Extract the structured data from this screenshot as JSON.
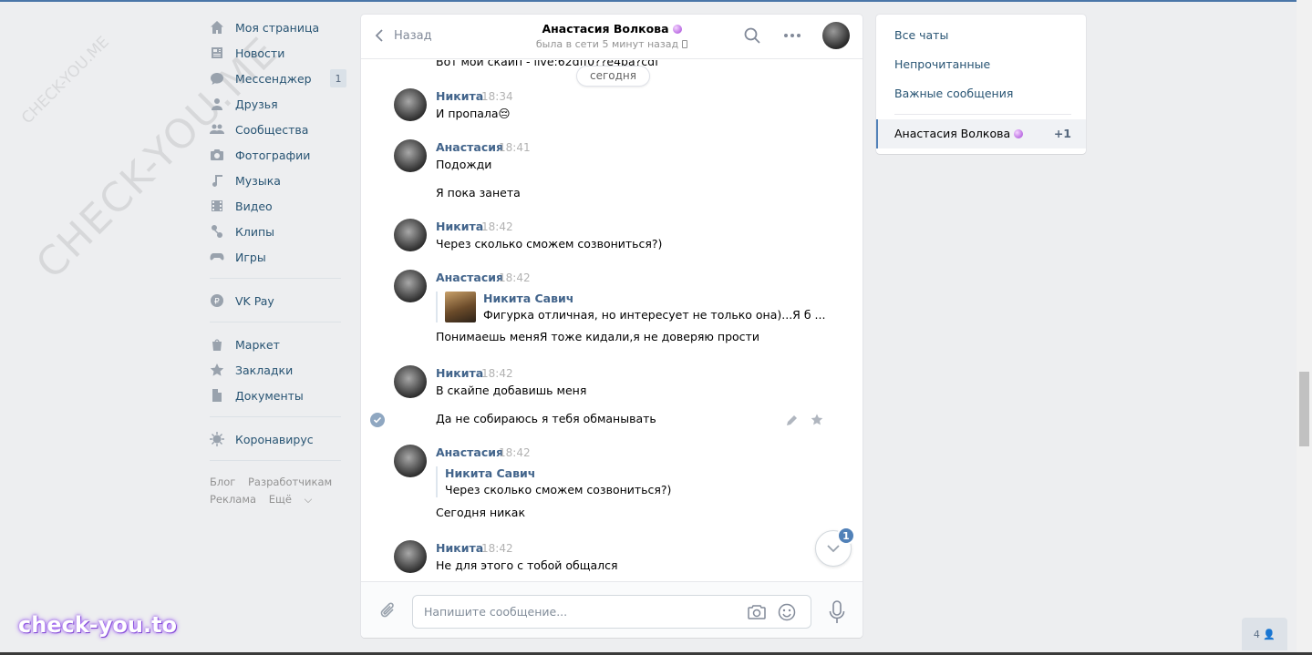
{
  "nav": {
    "items": [
      {
        "label": "Моя страница",
        "icon": "home-icon"
      },
      {
        "label": "Новости",
        "icon": "news-icon"
      },
      {
        "label": "Мессенджер",
        "icon": "messenger-icon",
        "badge": "1"
      },
      {
        "label": "Друзья",
        "icon": "friends-icon"
      },
      {
        "label": "Сообщества",
        "icon": "communities-icon"
      },
      {
        "label": "Фотографии",
        "icon": "camera-icon"
      },
      {
        "label": "Музыка",
        "icon": "music-icon"
      },
      {
        "label": "Видео",
        "icon": "video-icon"
      },
      {
        "label": "Клипы",
        "icon": "clips-icon"
      },
      {
        "label": "Игры",
        "icon": "gamepad-icon"
      }
    ],
    "vkpay": "VK Pay",
    "items2": [
      {
        "label": "Маркет",
        "icon": "market-icon"
      },
      {
        "label": "Закладки",
        "icon": "bookmark-icon"
      },
      {
        "label": "Документы",
        "icon": "document-icon"
      }
    ],
    "corona": "Коронавирус",
    "footer": {
      "blog": "Блог",
      "dev": "Разработчикам",
      "ads": "Реклама",
      "more": "Ещё"
    }
  },
  "chat": {
    "back": "Назад",
    "peer_name": "Анастасия Волкова",
    "peer_status": "была в сети 5 минут назад",
    "cut_text": "Вот мои скайп - live:62dff0??e4ba?cdf",
    "date_pill": "сегодня",
    "messages": [
      {
        "author": "Никита",
        "time": "18:34",
        "text": "И пропала😔"
      },
      {
        "author": "Анастасия",
        "time": "18:41",
        "text": "Подожди",
        "text2": "Я пока занета"
      },
      {
        "author": "Никита",
        "time": "18:42",
        "text": "Через сколько сможем созвониться?)"
      },
      {
        "author": "Анастасия",
        "time": "18:42",
        "fwd_name": "Никита Савич",
        "fwd_text": "Фигурка отличная, но интересует не только она)...Я б ...",
        "text": "Понимаешь меняЯ тоже кидали,я не доверяю прости"
      },
      {
        "author": "Никита",
        "time": "18:42",
        "text": "В скайпе добавишь меня",
        "text2": "Да не собираюсь я тебя обманывать"
      },
      {
        "author": "Анастасия",
        "time": "18:42",
        "fwd_name": "Никита Савич",
        "fwd_text": "Через сколько сможем созвониться?)",
        "text": "Сегодня никак"
      },
      {
        "author": "Никита",
        "time": "18:42",
        "text": "Не для этого с тобой общался"
      }
    ],
    "unread_badge": "1",
    "composer_placeholder": "Напишите сообщение..."
  },
  "right": {
    "all": "Все чаты",
    "unread": "Непрочитанные",
    "important": "Важные сообщения",
    "active_name": "Анастасия Волкова",
    "active_count": "+1"
  },
  "watermark": {
    "big": "CHECK-YOU.ME",
    "small": "CHECK-YOU.ME",
    "brand": "check-you.to"
  },
  "fab_count": "4"
}
